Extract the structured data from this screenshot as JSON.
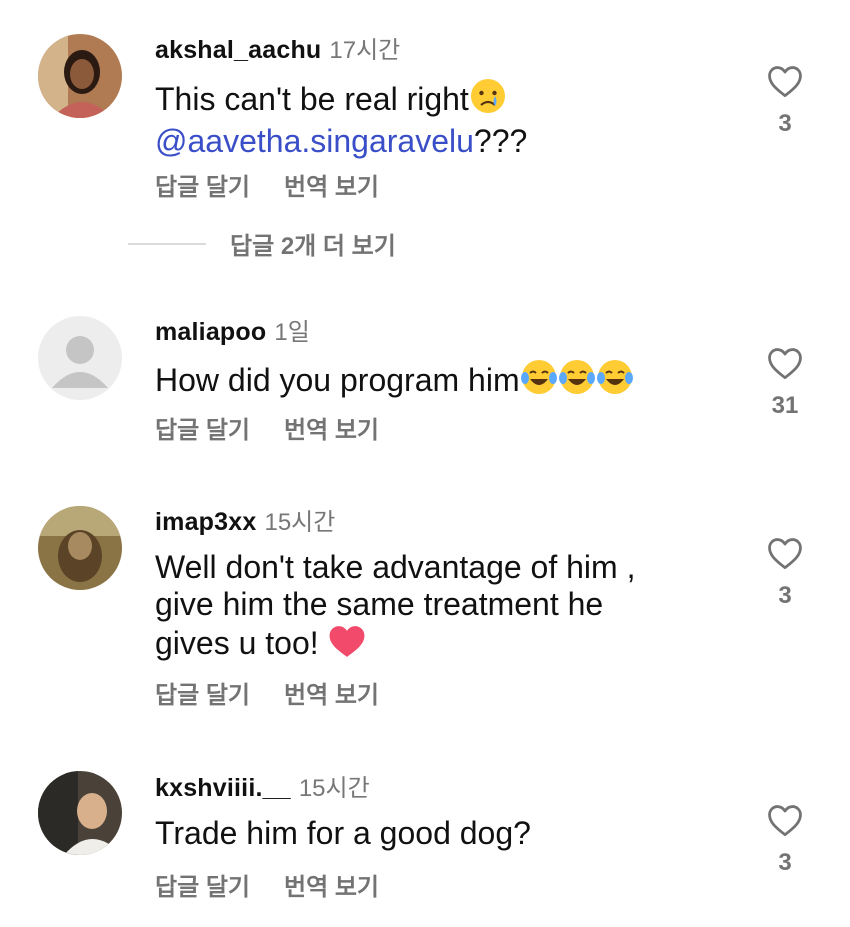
{
  "comments": [
    {
      "username": "akshal_aachu",
      "time": "17시간",
      "text_before": "This can't be real right",
      "mention": "@aavetha.singaravelu",
      "text_after": "???",
      "reply_label": "답글 달기",
      "translate_label": "번역 보기",
      "like_count": "3",
      "view_replies": "답글 2개 더 보기"
    },
    {
      "username": "maliapoo",
      "time": "1일",
      "text": "How did you program him",
      "reply_label": "답글 달기",
      "translate_label": "번역 보기",
      "like_count": "31"
    },
    {
      "username": "imap3xx",
      "time": "15시간",
      "line1": "Well don't take advantage of him ,",
      "line2": "give him the same treatment he",
      "line3": "gives u too!",
      "reply_label": "답글 달기",
      "translate_label": "번역 보기",
      "like_count": "3"
    },
    {
      "username": "kxshviiii.__",
      "time": "15시간",
      "text": "Trade him for a good dog?",
      "reply_label": "답글 달기",
      "translate_label": "번역 보기",
      "like_count": "3"
    }
  ],
  "icons": {
    "heart": "heart-outline-icon",
    "sad_emoji": "crying-face-emoji",
    "laugh_emoji": "tears-of-joy-emoji",
    "red_heart": "red-heart-emoji"
  },
  "colors": {
    "mention": "#3a4fc7",
    "secondary": "#737373",
    "divider": "#dbdbdb"
  }
}
